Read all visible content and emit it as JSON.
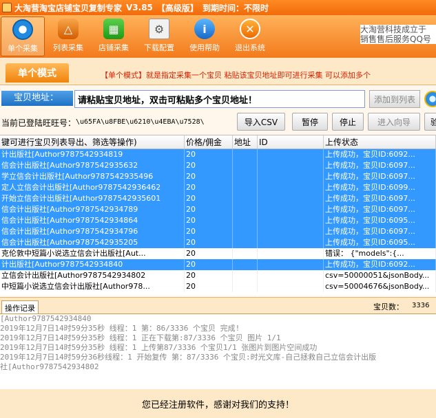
{
  "titlebar": {
    "title": "大淘营淘宝店铺宝贝复制专家",
    "version": "V3.85",
    "edition": "【高级版】",
    "expire": "到期时间：不限时"
  },
  "toolbar": {
    "items": [
      {
        "label": "单个采集",
        "icon": "magnify-single-icon"
      },
      {
        "label": "列表采集",
        "icon": "list-collect-icon"
      },
      {
        "label": "店铺采集",
        "icon": "shop-collect-icon"
      },
      {
        "label": "下载配置",
        "icon": "download-config-icon"
      },
      {
        "label": "使用帮助",
        "icon": "help-icon"
      },
      {
        "label": "退出系统",
        "icon": "exit-icon"
      }
    ],
    "icon_glyphs": [
      "",
      "△",
      "▦",
      "⚙",
      "i",
      "✕"
    ],
    "promo_line1": "大淘营科技成立于",
    "promo_line2": "销售售后服务QQ号"
  },
  "mode": {
    "tab_label": "单个模式",
    "description": "【单个模式】就是指定采集一个宝贝 粘贴该宝贝地址即可进行采集 可以添加多个"
  },
  "url": {
    "label": "宝贝地址：",
    "value": "请粘贴宝贝地址，双击可粘贴多个宝贝地址！",
    "add_button": "添加到列表"
  },
  "wangwang": {
    "label": "当前已登陆旺旺号：",
    "value": "\\u65FA\\u8FBE\\u6210\\u4EBA\\u7528\\",
    "buttons": {
      "import": "导入CSV",
      "pause": "暂停",
      "stop": "停止",
      "guide": "进入向导",
      "verify": "验"
    }
  },
  "table": {
    "headers": [
      "键可进行宝贝列表导出、筛选等操作)",
      "价格/佣金",
      "地址",
      "ID",
      "上传状态"
    ],
    "rows": [
      {
        "sel": true,
        "title": "计出版社[Author9787542934819",
        "price": "20",
        "addr": "",
        "id": "",
        "status": "上传成功，宝贝ID:6092..."
      },
      {
        "sel": true,
        "title": "信会计出版社[Author9787542935632",
        "price": "20",
        "addr": "",
        "id": "",
        "status": "上传成功，宝贝ID:6097..."
      },
      {
        "sel": true,
        "title": "学立信会计出版社[Author9787542935496",
        "price": "20",
        "addr": "",
        "id": "",
        "status": "上传成功，宝贝ID:6097..."
      },
      {
        "sel": true,
        "title": "定人立信会计出版社[Author9787542936462",
        "price": "20",
        "addr": "",
        "id": "",
        "status": "上传成功，宝贝ID:6099..."
      },
      {
        "sel": true,
        "title": "开始立信会计出版社[Author9787542935601",
        "price": "20",
        "addr": "",
        "id": "",
        "status": "上传成功，宝贝ID:6097..."
      },
      {
        "sel": true,
        "title": "信会计出版社[Author9787542934789",
        "price": "20",
        "addr": "",
        "id": "",
        "status": "上传成功，宝贝ID:6097..."
      },
      {
        "sel": true,
        "title": "信会计出版社[Author9787542934864",
        "price": "20",
        "addr": "",
        "id": "",
        "status": "上传成功，宝贝ID:6095..."
      },
      {
        "sel": true,
        "title": "信会计出版社[Author9787542934796",
        "price": "20",
        "addr": "",
        "id": "",
        "status": "上传成功，宝贝ID:6097..."
      },
      {
        "sel": true,
        "title": "信会计出版社[Author9787542935205",
        "price": "20",
        "addr": "",
        "id": "",
        "status": "上传成功，宝贝ID:6095..."
      },
      {
        "sel": false,
        "title": "克伦敦中短篇小说选立信会计出版社[Aut...",
        "price": "20",
        "addr": "",
        "id": "",
        "status": "错误：    {\"models\":{..."
      },
      {
        "sel": true,
        "title": "计出版社[Author9787542934840",
        "price": "20",
        "addr": "",
        "id": "",
        "status": "上传成功，宝贝ID:6092..."
      },
      {
        "sel": false,
        "title": "立信会计出版社[Author9787542934802",
        "price": "20",
        "addr": "",
        "id": "",
        "status": "csv=50000051&jsonBody..."
      },
      {
        "sel": false,
        "title": "中短篇小说选立信会计出版社[Author978...",
        "price": "20",
        "addr": "",
        "id": "",
        "status": "csv=50004676&jsonBody..."
      }
    ]
  },
  "log": {
    "tab_label": "操作记录",
    "count_label": "宝贝数：",
    "count_value": "3336",
    "lines": [
      "[Author9787542934840",
      "2019年12月7日14时59分35秒 线程：1 第：86/3336 个宝贝 完成!",
      "2019年12月7日14时59分35秒 线程：1  正在下载第:87/3336 个宝贝 图片 1/1",
      "2019年12月7日14时59分35秒 线程：1  上传第87/3336 个宝贝1/1 张图片到图片空间成功",
      "2019年12月7日14时59分36秒线程：1  开始复传 第：87/3336 个宝贝:时光文库-自己拯救自己立信会计出版",
      "社[Author9787542934802"
    ]
  },
  "footer": {
    "message": "您已经注册软件，感谢对我们的支持！"
  }
}
